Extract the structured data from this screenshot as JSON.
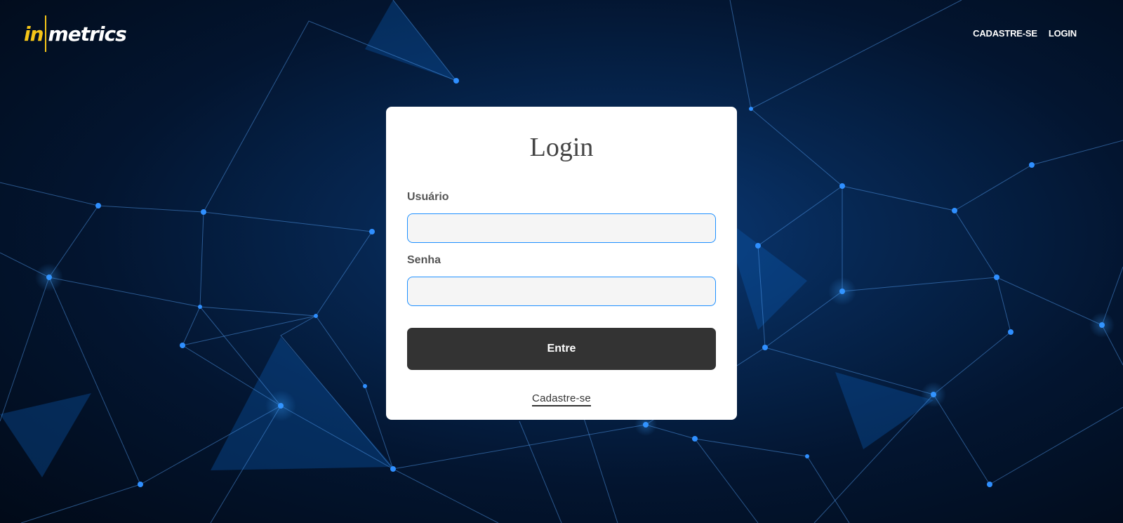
{
  "brand": {
    "logo_prefix": "in",
    "logo_suffix": "metrics",
    "accent_color": "#f5c518"
  },
  "nav": {
    "items": [
      {
        "label": "CADASTRE-SE"
      },
      {
        "label": "LOGIN"
      }
    ]
  },
  "login_form": {
    "title": "Login",
    "username": {
      "label": "Usuário",
      "value": "",
      "placeholder": ""
    },
    "password": {
      "label": "Senha",
      "value": "",
      "placeholder": ""
    },
    "submit_label": "Entre",
    "register_link": "Cadastre-se"
  },
  "colors": {
    "input_border": "#1e90ff",
    "button_bg": "#333333"
  }
}
